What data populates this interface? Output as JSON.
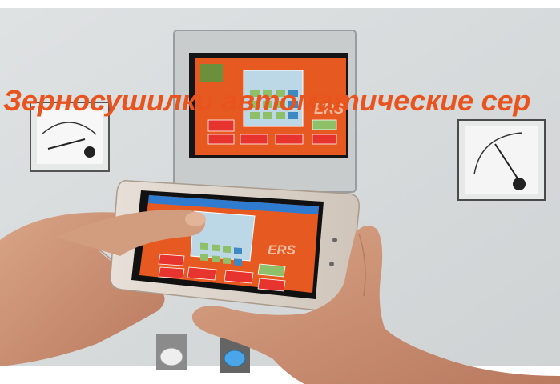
{
  "overlay": {
    "title": "Зерносушилки автоматические сер"
  },
  "scene": {
    "description_icon": "photo-icon",
    "panel_brand_text": "ERS",
    "phone_brand_text": "ERS",
    "colors": {
      "panel": "#d9dbdc",
      "screen_orange": "#e65a22",
      "overlay_text": "#e8531e"
    }
  }
}
